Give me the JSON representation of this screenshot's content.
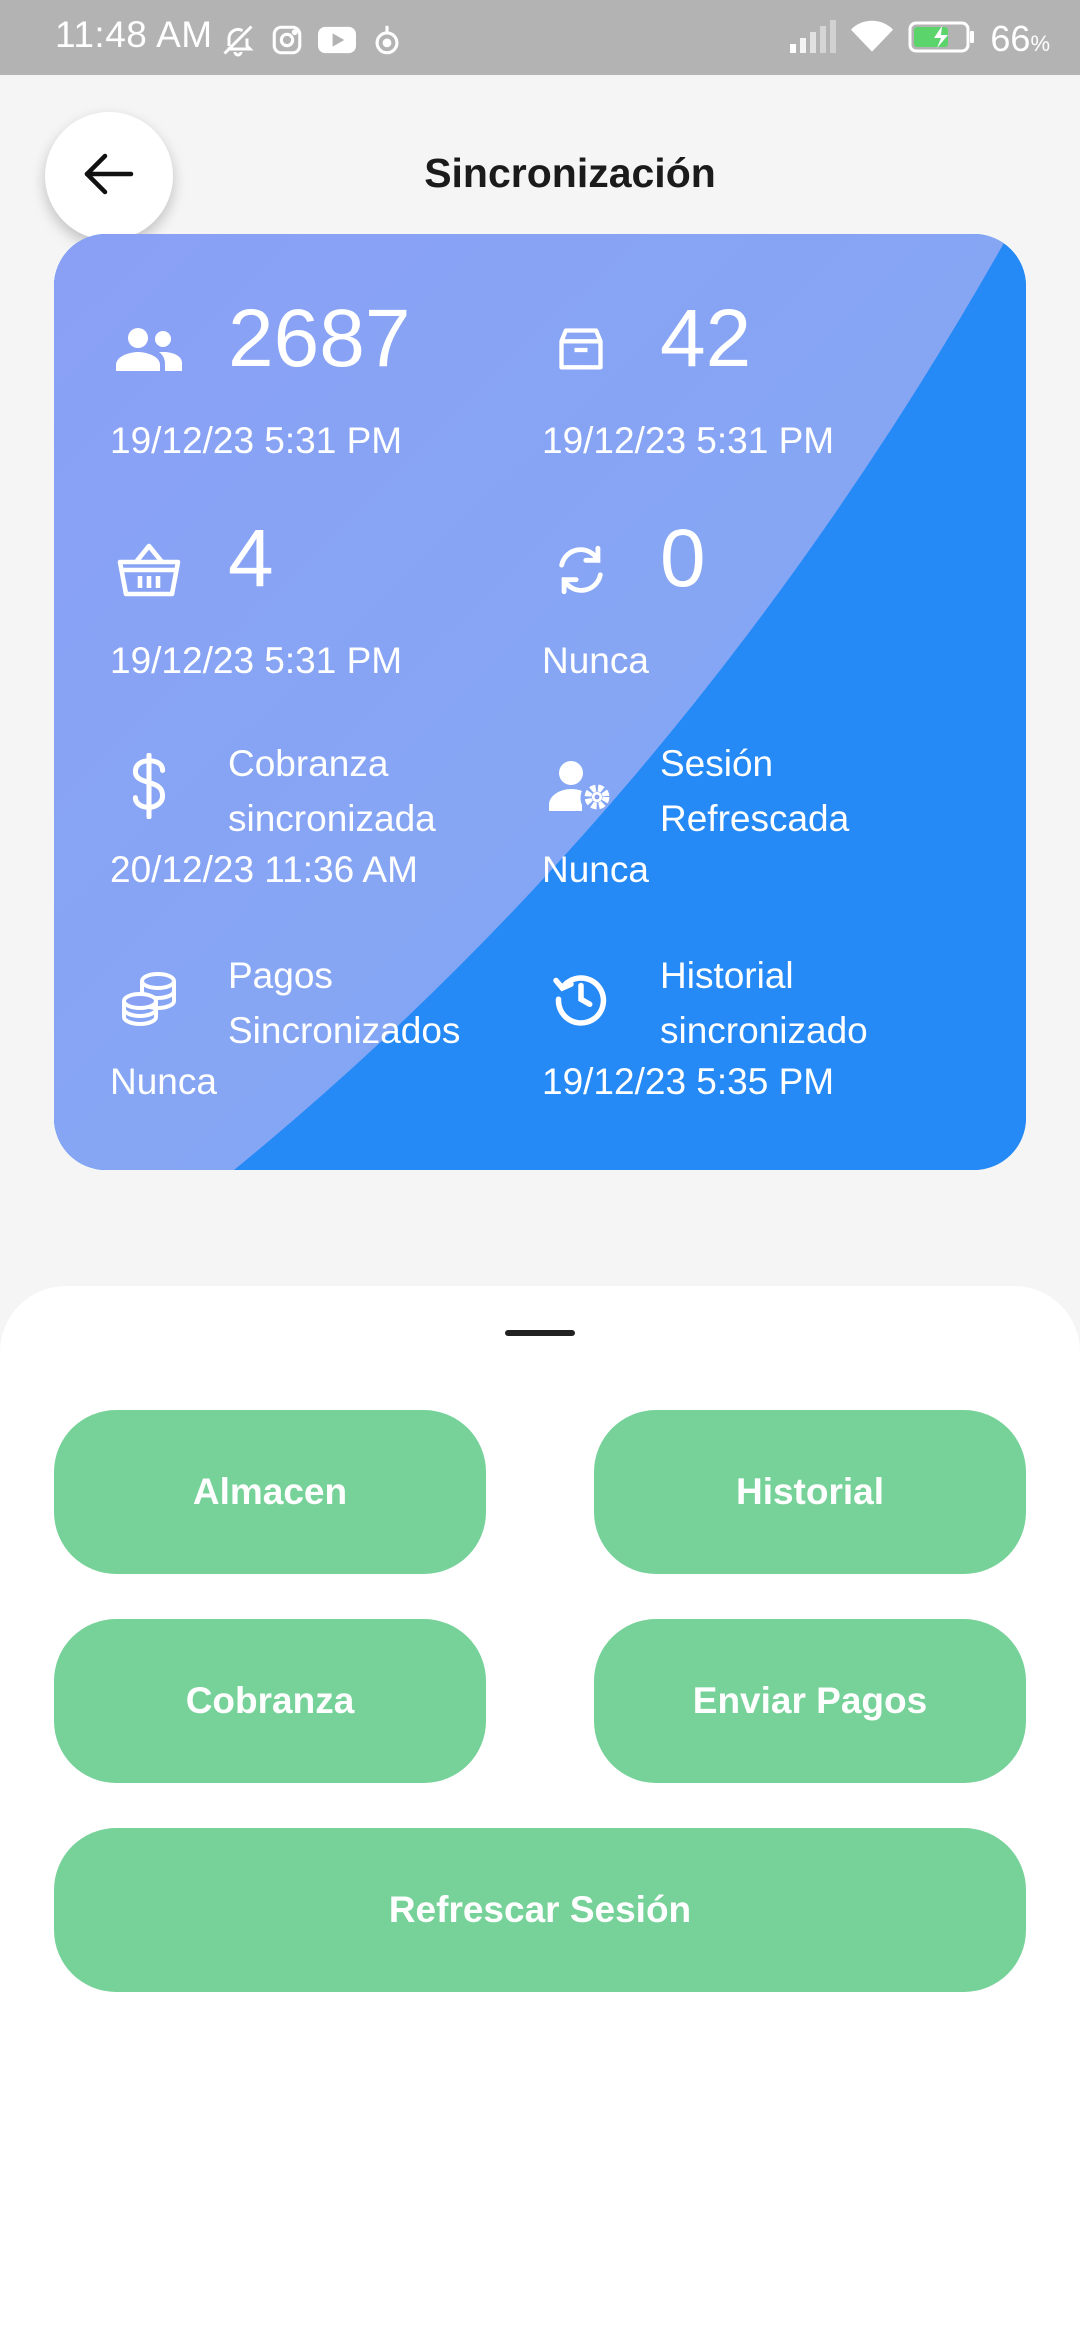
{
  "status_bar": {
    "time": "11:48 AM",
    "battery_percent": "66",
    "battery_unit": "%",
    "icons_left": [
      "bell-muted-icon",
      "instagram-icon",
      "youtube-icon",
      "location-icon"
    ],
    "icons_right": [
      "signal-icon",
      "wifi-icon",
      "battery-charging-icon"
    ]
  },
  "header": {
    "title": "Sincronización",
    "back_icon": "arrow-left-icon"
  },
  "stats": {
    "clients": {
      "icon": "people-icon",
      "value": "2687",
      "date": "19/12/23 5:31 PM"
    },
    "products": {
      "icon": "box-icon",
      "value": "42",
      "date": "19/12/23 5:31 PM"
    },
    "orders": {
      "icon": "basket-icon",
      "value": "4",
      "date": "19/12/23 5:31 PM"
    },
    "pending": {
      "icon": "sync-icon",
      "value": "0",
      "date": "Nunca"
    },
    "cobranza": {
      "icon": "dollar-icon",
      "label": "Cobranza sincronizada",
      "date": "20/12/23 11:36 AM"
    },
    "session": {
      "icon": "user-gear-icon",
      "label": "Sesión Refrescada",
      "date": "Nunca"
    },
    "payments": {
      "icon": "coins-icon",
      "label": "Pagos Sincronizados",
      "date": "Nunca"
    },
    "history": {
      "icon": "history-icon",
      "label": "Historial sincronizado",
      "date": "19/12/23 5:35 PM"
    }
  },
  "colors": {
    "card_blue": "#2589f6",
    "card_lavender": "#8aa0f5",
    "button_green": "#77d299",
    "status_bar": "#b3b3b3"
  },
  "actions": {
    "almacen": "Almacen",
    "historial": "Historial",
    "cobranza": "Cobranza",
    "enviar_pagos": "Enviar Pagos",
    "refrescar_sesion": "Refrescar Sesión"
  }
}
